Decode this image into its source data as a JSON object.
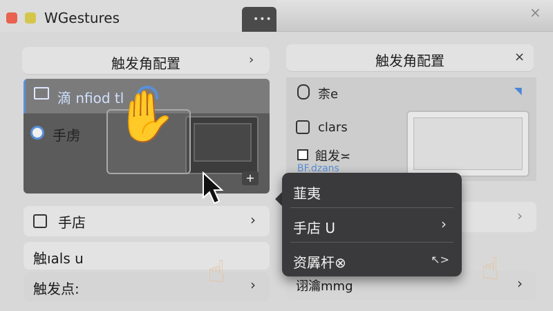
{
  "window": {
    "title": "WGestures",
    "tab_dots": "•••",
    "close": "×"
  },
  "left_panel": {
    "header_title": "触发角配置",
    "header_btn": "›",
    "selected_row_label": "滴 nfiod tl",
    "hand_row_label": "手虏",
    "row1_label": "手店",
    "row1_chevron": "›",
    "row2_label": "触ıals u",
    "row3_label": "触发点:",
    "row3_chevron": "›",
    "plus_badge": "+"
  },
  "right_panel": {
    "header_title": "触发角配置",
    "header_btn": "×",
    "row_a_label": "柰e",
    "row_b_label": "clars",
    "row_c_label": "飷发≍",
    "row_c_sub": "BF.dzans",
    "row_d_chevron": "›",
    "row_e_label": "诩瀹mmg",
    "row_e_chevron": "›"
  },
  "context_menu": {
    "item1": "韮夷",
    "item2": "手店 U",
    "item3": "资羼杆⊗",
    "item3_shortcut": "↖>"
  },
  "icons": {
    "hand": "hand-icon",
    "cursor": "cursor-icon",
    "pointing": "pointing-hand-icon"
  },
  "colors": {
    "accent_blue": "#5a8fd8",
    "traffic_red": "#e8624f",
    "traffic_yellow": "#d4c64a",
    "menu_bg": "#3a3a3c"
  }
}
